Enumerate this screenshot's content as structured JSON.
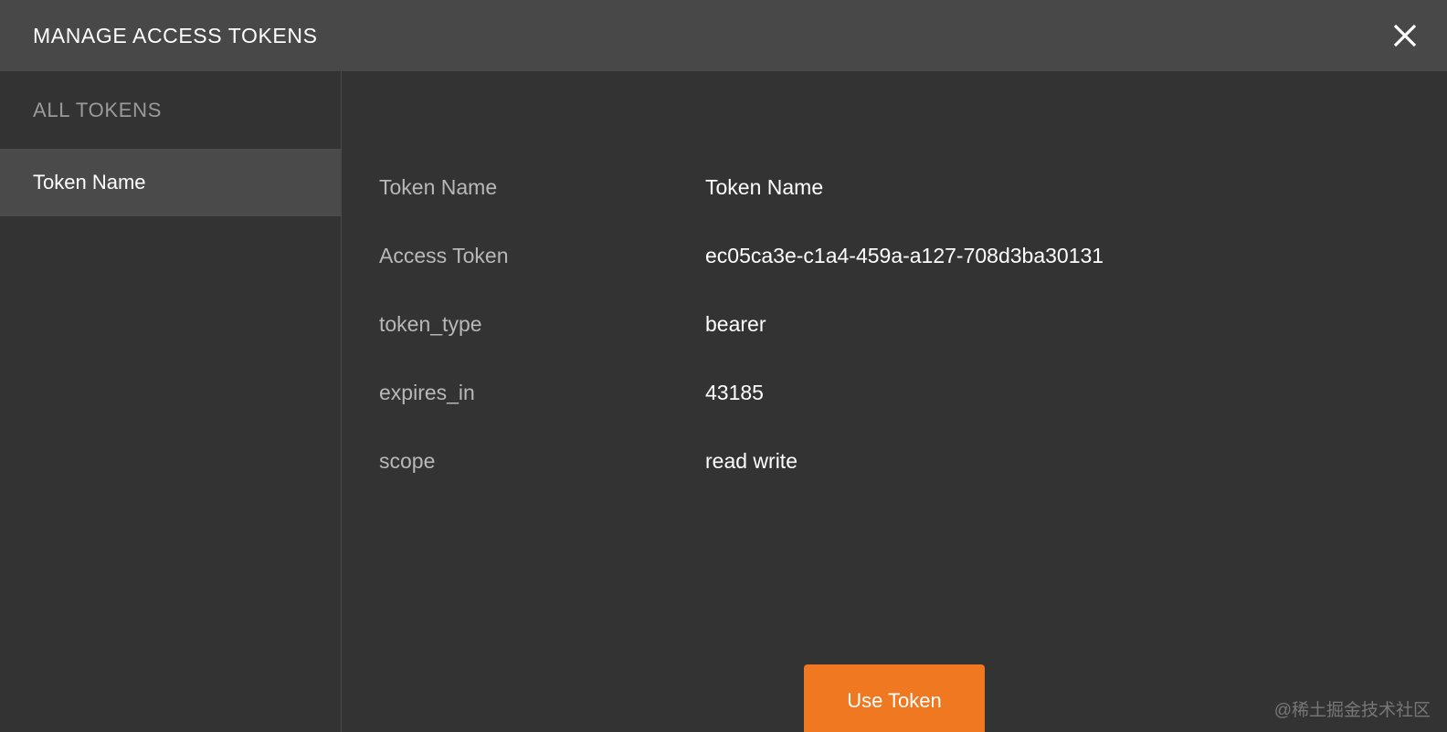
{
  "header": {
    "title": "MANAGE ACCESS TOKENS",
    "close_icon": "close-icon",
    "background": "#484848"
  },
  "sidebar": {
    "heading": "ALL TOKENS",
    "items": [
      {
        "label": "Token Name",
        "selected": true
      }
    ],
    "selected_background": "#4a4a4a"
  },
  "detail": {
    "rows": [
      {
        "label": "Token Name",
        "value": "Token Name"
      },
      {
        "label": "Access Token",
        "value": "ec05ca3e-c1a4-459a-a127-708d3ba30131"
      },
      {
        "label": "token_type",
        "value": "bearer"
      },
      {
        "label": "expires_in",
        "value": "43185"
      },
      {
        "label": "scope",
        "value": "read write"
      }
    ]
  },
  "actions": {
    "use_token_label": "Use Token",
    "use_token_color": "#f07821"
  },
  "watermark": {
    "text": "@稀土掘金技术社区"
  },
  "theme": {
    "body_background": "#333333",
    "label_color": "#b8b8b8",
    "value_color": "#ffffff",
    "divider_color": "#4a4a4a"
  }
}
